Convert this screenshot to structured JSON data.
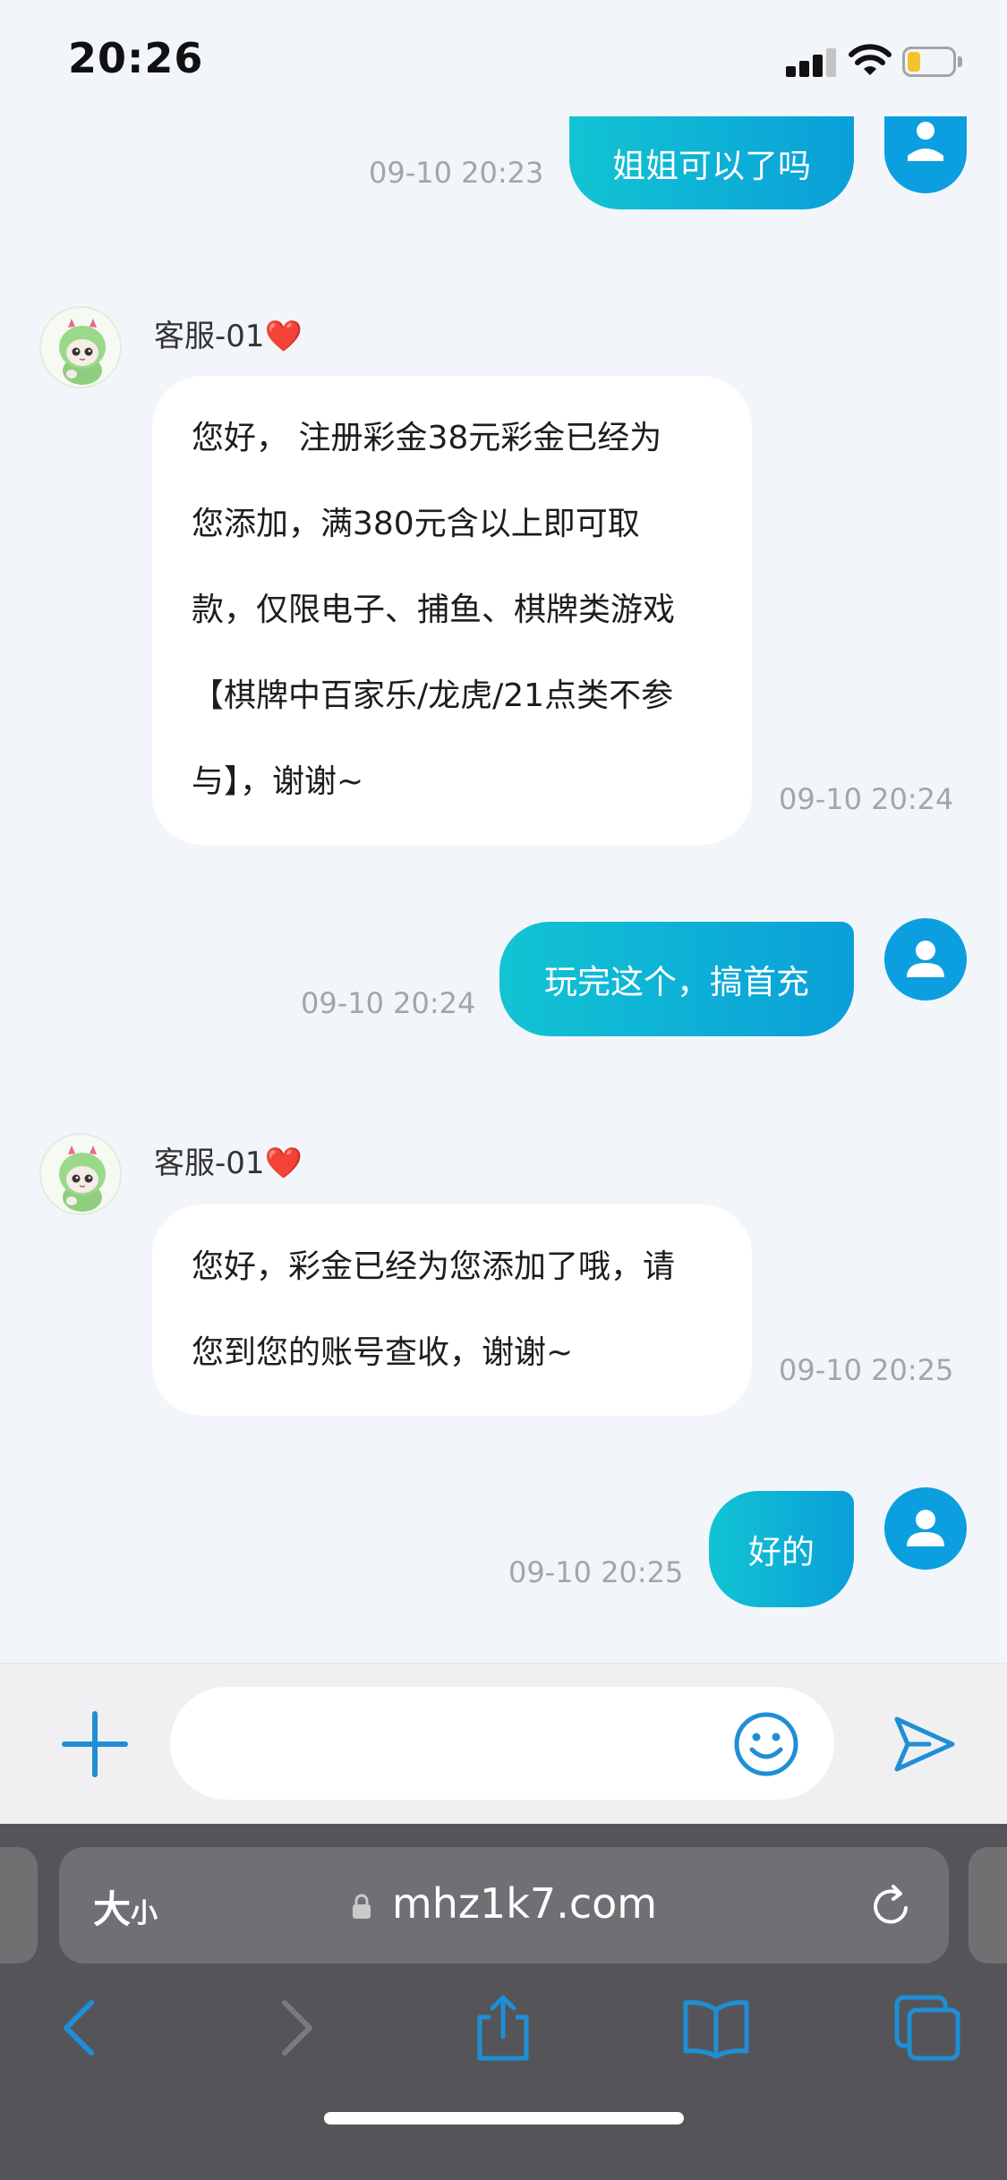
{
  "status": {
    "time": "20:26",
    "battery_level_fraction": 0.3
  },
  "messages": [
    {
      "side": "out",
      "timestamp": "09-10 20:23",
      "text": "姐姐可以了吗"
    },
    {
      "side": "in",
      "sender": "客服-01",
      "sender_suffix": "❤️",
      "timestamp": "09-10 20:24",
      "lines": [
        "您好， 注册彩金38元彩金已经为",
        "您添加，满380元含以上即可取",
        "款，仅限电子、捕鱼、棋牌类游戏",
        "【棋牌中百家乐/龙虎/21点类不参",
        "与】，谢谢~"
      ]
    },
    {
      "side": "out",
      "timestamp": "09-10 20:24",
      "text": "玩完这个，搞首充"
    },
    {
      "side": "in",
      "sender": "客服-01",
      "sender_suffix": "❤️",
      "timestamp": "09-10 20:25",
      "lines": [
        "您好，彩金已经为您添加了哦，请",
        "您到您的账号查收，谢谢~"
      ]
    },
    {
      "side": "out",
      "timestamp": "09-10 20:25",
      "text": "好的"
    }
  ],
  "input": {
    "placeholder": "",
    "value": ""
  },
  "icons": {
    "add": "plus-icon",
    "emoji": "smiley-icon",
    "send": "send-icon",
    "lock": "lock-icon",
    "reload": "reload-icon",
    "back": "chevron-left-icon",
    "forward": "chevron-right-icon",
    "share": "share-icon",
    "bookmarks": "book-icon",
    "tabs": "tabs-icon"
  },
  "browser": {
    "text_size_label_big": "大",
    "text_size_label_small": "小",
    "domain": "mhz1k7.com"
  },
  "colors": {
    "accent": "#0a9fd9",
    "bubble_gradient_start": "#12c4d3",
    "heart": "#e5252c",
    "toolbar": "#555559"
  }
}
